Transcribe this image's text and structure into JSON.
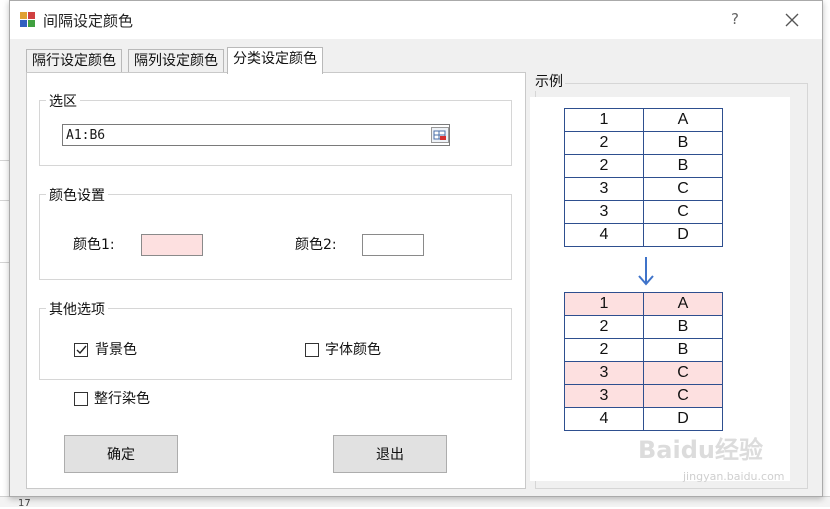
{
  "window": {
    "title": "间隔设定颜色",
    "help_label": "?"
  },
  "tabs": [
    {
      "label": "隔行设定颜色",
      "active": false
    },
    {
      "label": "隔列设定颜色",
      "active": false
    },
    {
      "label": "分类设定颜色",
      "active": true
    }
  ],
  "selection": {
    "group_title": "选区",
    "range_value": "A1:B6"
  },
  "color_settings": {
    "group_title": "颜色设置",
    "color1_label": "颜色1:",
    "color1_value": "#fde0e0",
    "color2_label": "颜色2:",
    "color2_value": "#ffffff"
  },
  "other_options": {
    "group_title": "其他选项",
    "background_label": "背景色",
    "background_checked": true,
    "font_color_label": "字体颜色",
    "font_color_checked": false,
    "whole_row_label": "整行染色",
    "whole_row_checked": false
  },
  "buttons": {
    "ok": "确定",
    "exit": "退出"
  },
  "example": {
    "title": "示例",
    "before_rows": [
      [
        "1",
        "A"
      ],
      [
        "2",
        "B"
      ],
      [
        "2",
        "B"
      ],
      [
        "3",
        "C"
      ],
      [
        "3",
        "C"
      ],
      [
        "4",
        "D"
      ]
    ],
    "after_rows": [
      [
        "1",
        "A"
      ],
      [
        "2",
        "B"
      ],
      [
        "2",
        "B"
      ],
      [
        "3",
        "C"
      ],
      [
        "3",
        "C"
      ],
      [
        "4",
        "D"
      ]
    ],
    "after_highlighted": [
      true,
      false,
      false,
      true,
      true,
      false
    ],
    "highlight_color": "#fde0e0",
    "border_color": "#2e4f8f"
  },
  "background_sheet": {
    "row_label": "17"
  },
  "watermark": {
    "brand": "Baidu经验",
    "url": "jingyan.baidu.com"
  }
}
